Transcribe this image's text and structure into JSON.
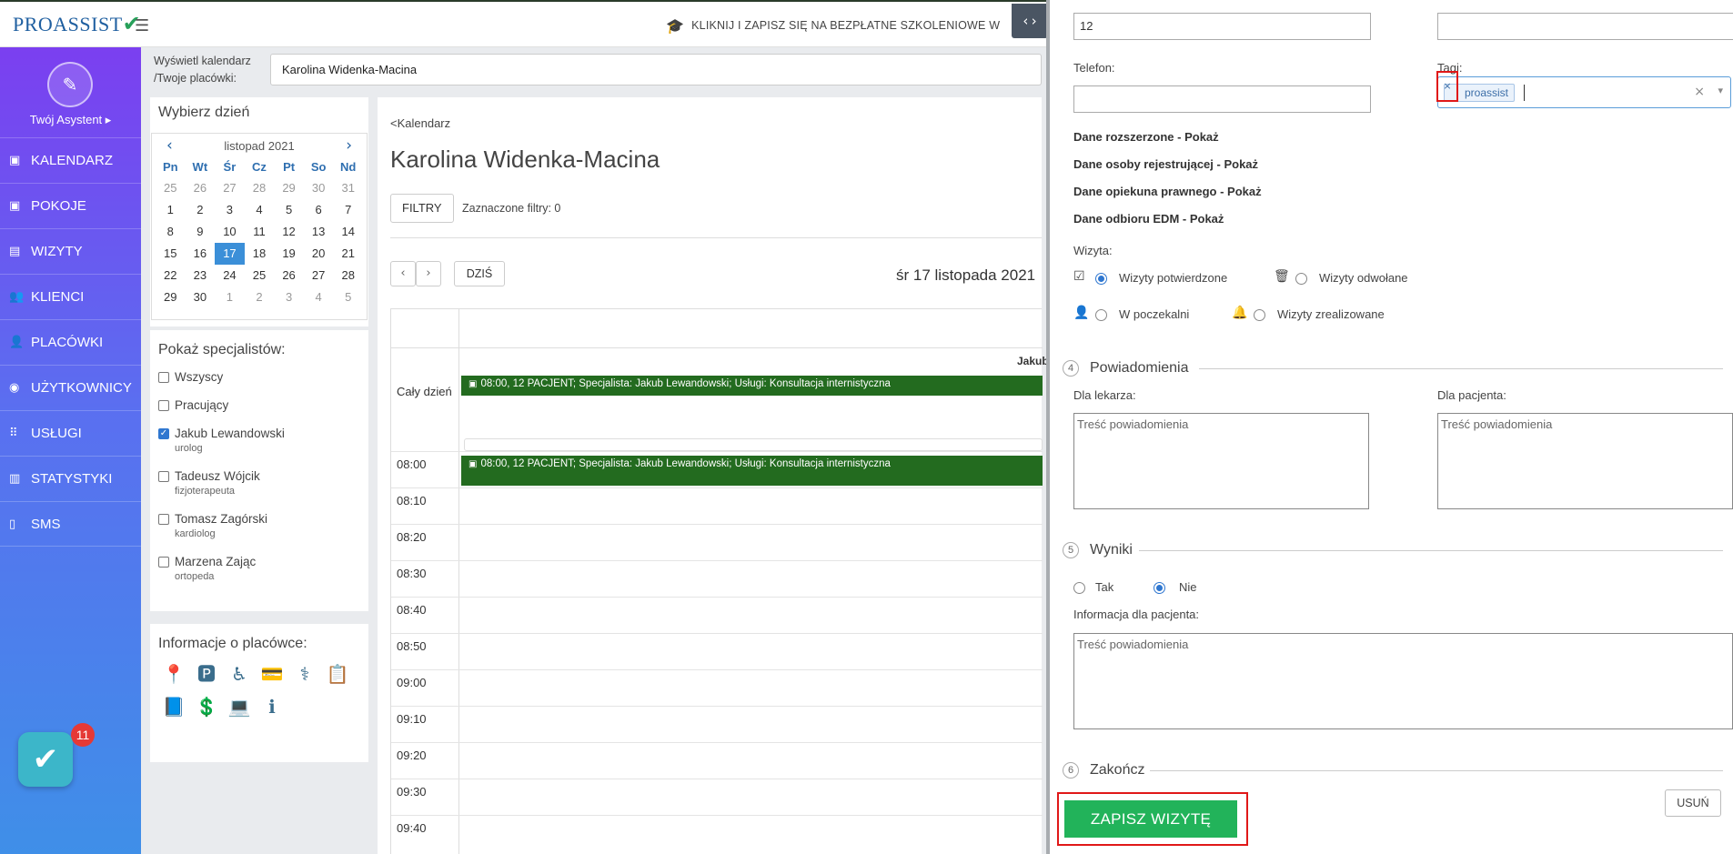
{
  "app": {
    "logo_text": "PROASSIST",
    "promo_text": "KLIKNIJ I ZAPISZ SIĘ NA BEZPŁATNE SZKOLENIOWE W",
    "assistant_label": "Twój Asystent",
    "badge_count": "11"
  },
  "sidebar": {
    "items": [
      {
        "label": "KALENDARZ",
        "icon": "calendar-icon"
      },
      {
        "label": "POKOJE",
        "icon": "calendar-icon"
      },
      {
        "label": "WIZYTY",
        "icon": "list-icon"
      },
      {
        "label": "KLIENCI",
        "icon": "users-icon"
      },
      {
        "label": "PLACÓWKI",
        "icon": "user-plus-icon"
      },
      {
        "label": "UŻYTKOWNICY",
        "icon": "user-circle-icon"
      },
      {
        "label": "USŁUGI",
        "icon": "grid-icon"
      },
      {
        "label": "STATYSTYKI",
        "icon": "bar-chart-icon"
      },
      {
        "label": "SMS",
        "icon": "phone-icon"
      }
    ]
  },
  "calendar_select": {
    "label_line1": "Wyświetl kalendarz",
    "label_line2": "/Twoje placówki:",
    "value": "Karolina Widenka-Macina"
  },
  "day_picker": {
    "title": "Wybierz dzień",
    "month": "listopad 2021",
    "weekdays": [
      "Pn",
      "Wt",
      "Śr",
      "Cz",
      "Pt",
      "So",
      "Nd"
    ],
    "weeks": [
      [
        "25",
        "26",
        "27",
        "28",
        "29",
        "30",
        "31"
      ],
      [
        "1",
        "2",
        "3",
        "4",
        "5",
        "6",
        "7"
      ],
      [
        "8",
        "9",
        "10",
        "11",
        "12",
        "13",
        "14"
      ],
      [
        "15",
        "16",
        "17",
        "18",
        "19",
        "20",
        "21"
      ],
      [
        "22",
        "23",
        "24",
        "25",
        "26",
        "27",
        "28"
      ],
      [
        "29",
        "30",
        "1",
        "2",
        "3",
        "4",
        "5"
      ]
    ],
    "selected": "17"
  },
  "specialists": {
    "title": "Pokaż specjalistów:",
    "items": [
      {
        "name": "Wszyscy",
        "role": "",
        "checked": false
      },
      {
        "name": "Pracujący",
        "role": "",
        "checked": false
      },
      {
        "name": "Jakub Lewandowski",
        "role": "urolog",
        "checked": true
      },
      {
        "name": "Tadeusz Wójcik",
        "role": "fizjoterapeuta",
        "checked": false
      },
      {
        "name": "Tomasz Zagórski",
        "role": "kardiolog",
        "checked": false
      },
      {
        "name": "Marzena Zając",
        "role": "ortopeda",
        "checked": false
      }
    ]
  },
  "facility_info": {
    "title": "Informacje o placówce:"
  },
  "calendar": {
    "back_link": "<Kalendarz",
    "title": "Karolina Widenka-Macina",
    "filters_button": "FILTRY",
    "filters_text": "Zaznaczone filtry: 0",
    "today_button": "DZIŚ",
    "date_title": "śr 17 listopada 2021",
    "all_day_label": "Cały dzień",
    "column_head": "Jakub",
    "event_text": "08:00, 12 PACJENT; Specjalista: Jakub Lewandowski; Usługi: Konsultacja internistyczna",
    "times": [
      "08:00",
      "08:10",
      "08:20",
      "08:30",
      "08:40",
      "08:50",
      "09:00",
      "09:10",
      "09:20",
      "09:30",
      "09:40"
    ]
  },
  "form": {
    "top_input_value": "12",
    "phone_label": "Telefon:",
    "tags_label": "Tagi:",
    "tag_value": "proassist",
    "tag_remove": "×",
    "tag_clear": "×",
    "expand_links": [
      "Dane rozszerzone - Pokaż",
      "Dane osoby rejestrującej - Pokaż",
      "Dane opiekuna prawnego - Pokaż",
      "Dane odbioru EDM - Pokaż"
    ],
    "visit_label": "Wizyta:",
    "visit_options": {
      "confirmed": "Wizyty potwierdzone",
      "cancelled": "Wizyty odwołane",
      "waiting": "W poczekalni",
      "realized": "Wizyty zrealizowane"
    },
    "sec4_num": "4",
    "sec4_title": "Powiadomienia",
    "doctor_label": "Dla lekarza:",
    "patient_label": "Dla pacjenta:",
    "notif_placeholder": "Treść powiadomienia",
    "sec5_num": "5",
    "sec5_title": "Wyniki",
    "yes_label": "Tak",
    "no_label": "Nie",
    "patient_info_label": "Informacja dla pacjenta:",
    "sec6_num": "6",
    "sec6_title": "Zakończ",
    "save_button": "ZAPISZ WIZYTĘ",
    "delete_button": "USUŃ"
  },
  "colors": {
    "sidebar_top": "#7b3ff0",
    "sidebar_bottom": "#3f8fe8",
    "event_green": "#236b1f",
    "save_green": "#22b35a",
    "highlight_red": "#e01818"
  }
}
